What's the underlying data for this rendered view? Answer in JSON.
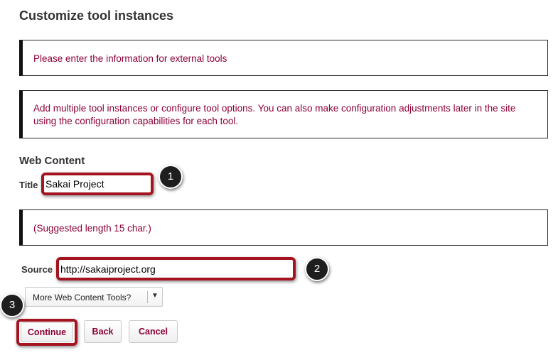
{
  "page": {
    "title": "Customize tool instances"
  },
  "messages": {
    "external_tools": "Please enter the information for external tools",
    "multiple_instances": "Add multiple tool instances or configure tool options. You can also make configuration adjustments later in the site using the configuration capabilities for each tool.",
    "suggested_length": "(Suggested length 15 char.)"
  },
  "web_content": {
    "heading": "Web Content",
    "title_label": "Title",
    "title_value": "Sakai Project",
    "source_label": "Source",
    "source_value": "http://sakaiproject.org",
    "more_tools_label": "More Web Content Tools?",
    "more_tools_icon": "caret-down-icon"
  },
  "callouts": {
    "one": "1",
    "two": "2",
    "three": "3"
  },
  "buttons": {
    "continue": "Continue",
    "back": "Back",
    "cancel": "Cancel"
  },
  "colors": {
    "message_text": "#8d0037",
    "highlight_border": "#a31420",
    "callout_fill": "#1e1e1e"
  }
}
